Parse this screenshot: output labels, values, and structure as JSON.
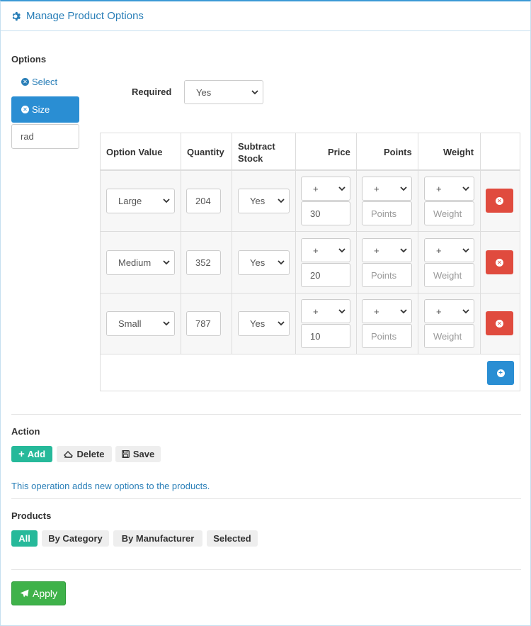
{
  "header": {
    "title": "Manage Product Options",
    "icon": "gear-icon"
  },
  "options": {
    "label": "Options",
    "items": [
      {
        "label": "Select",
        "active": false
      },
      {
        "label": "Size",
        "active": true
      }
    ],
    "new_option_value": "rad"
  },
  "required": {
    "label": "Required",
    "value": "Yes"
  },
  "table": {
    "headers": [
      "Option Value",
      "Quantity",
      "Subtract Stock",
      "Price",
      "Points",
      "Weight"
    ],
    "rows": [
      {
        "option_value": "Large",
        "quantity": "204",
        "subtract": "Yes",
        "price_prefix": "+",
        "price": "30",
        "points_prefix": "+",
        "points_placeholder": "Points",
        "weight_prefix": "+",
        "weight_placeholder": "Weight"
      },
      {
        "option_value": "Medium",
        "quantity": "352",
        "subtract": "Yes",
        "price_prefix": "+",
        "price": "20",
        "points_prefix": "+",
        "points_placeholder": "Points",
        "weight_prefix": "+",
        "weight_placeholder": "Weight"
      },
      {
        "option_value": "Small",
        "quantity": "787",
        "subtract": "Yes",
        "price_prefix": "+",
        "price": "10",
        "points_prefix": "+",
        "points_placeholder": "Points",
        "weight_prefix": "+",
        "weight_placeholder": "Weight"
      }
    ]
  },
  "action": {
    "label": "Action",
    "buttons": {
      "add": "Add",
      "delete": "Delete",
      "save": "Save"
    },
    "selected": "add",
    "info": "This operation adds new options to the products."
  },
  "products": {
    "label": "Products",
    "filters": [
      "All",
      "By Category",
      "By Manufacturer",
      "Selected"
    ],
    "selected": "All"
  },
  "apply_label": "Apply",
  "colors": {
    "primary": "#2a8ed3",
    "danger": "#e04b3e",
    "success": "#26b99a",
    "apply": "#3fb24a"
  }
}
